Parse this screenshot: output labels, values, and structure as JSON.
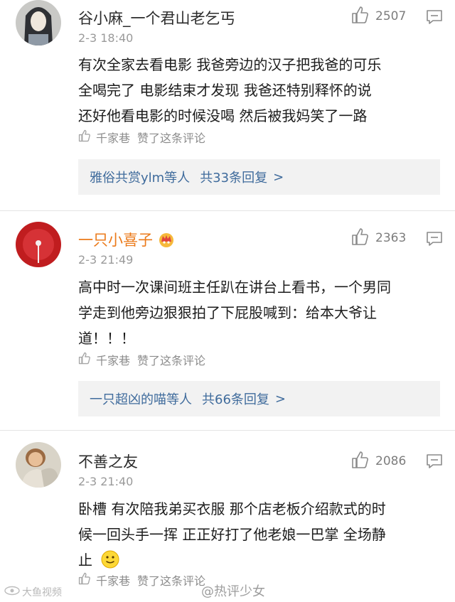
{
  "comments": [
    {
      "username": "谷小麻_一个君山老乞丐",
      "time": "2-3 18:40",
      "likes": "2507",
      "lines": [
        "有次全家去看电影  我爸旁边的汉子把我爸的可乐",
        "全喝完了  电影结束才发现  我爸还特别释怀的说",
        "还好他看电影的时候没喝  然后被我妈笑了一路"
      ],
      "liked_by": "千家巷",
      "liked_label": "赞了这条评论",
      "reply_summary": {
        "names": "雅俗共赏ylm等人",
        "count": "共33条回复",
        "arrow": ">"
      }
    },
    {
      "username": "一只小喜子",
      "time": "2-3 21:49",
      "likes": "2363",
      "lines": [
        "高中时一次课间班主任趴在讲台上看书，一个男同",
        "学走到他旁边狠狠拍了下屁股喊到：给本大爷让",
        "道！！！"
      ],
      "liked_by": "千家巷",
      "liked_label": "赞了这条评论",
      "reply_summary": {
        "names": "一只超凶的喵等人",
        "count": "共66条回复",
        "arrow": ">"
      }
    },
    {
      "username": "不善之友",
      "time": "2-3 21:40",
      "likes": "2086",
      "lines": [
        "卧槽  有次陪我弟买衣服  那个店老板介绍款式的时",
        "候一回头手一挥  正正好打了他老娘一巴掌  全场静",
        "止"
      ],
      "liked_by": "千家巷",
      "liked_label": "赞了这条评论"
    }
  ],
  "watermarks": {
    "left": "大鱼视频",
    "right": "@热评少女"
  },
  "colors": {
    "vip_name": "#eb7a1a",
    "link": "#3f6b9c",
    "meta": "#9a9a9a"
  },
  "icons": [
    "thumbs-up-icon",
    "comment-reply-icon",
    "crown-badge-icon",
    "smiley-emoji-icon"
  ]
}
